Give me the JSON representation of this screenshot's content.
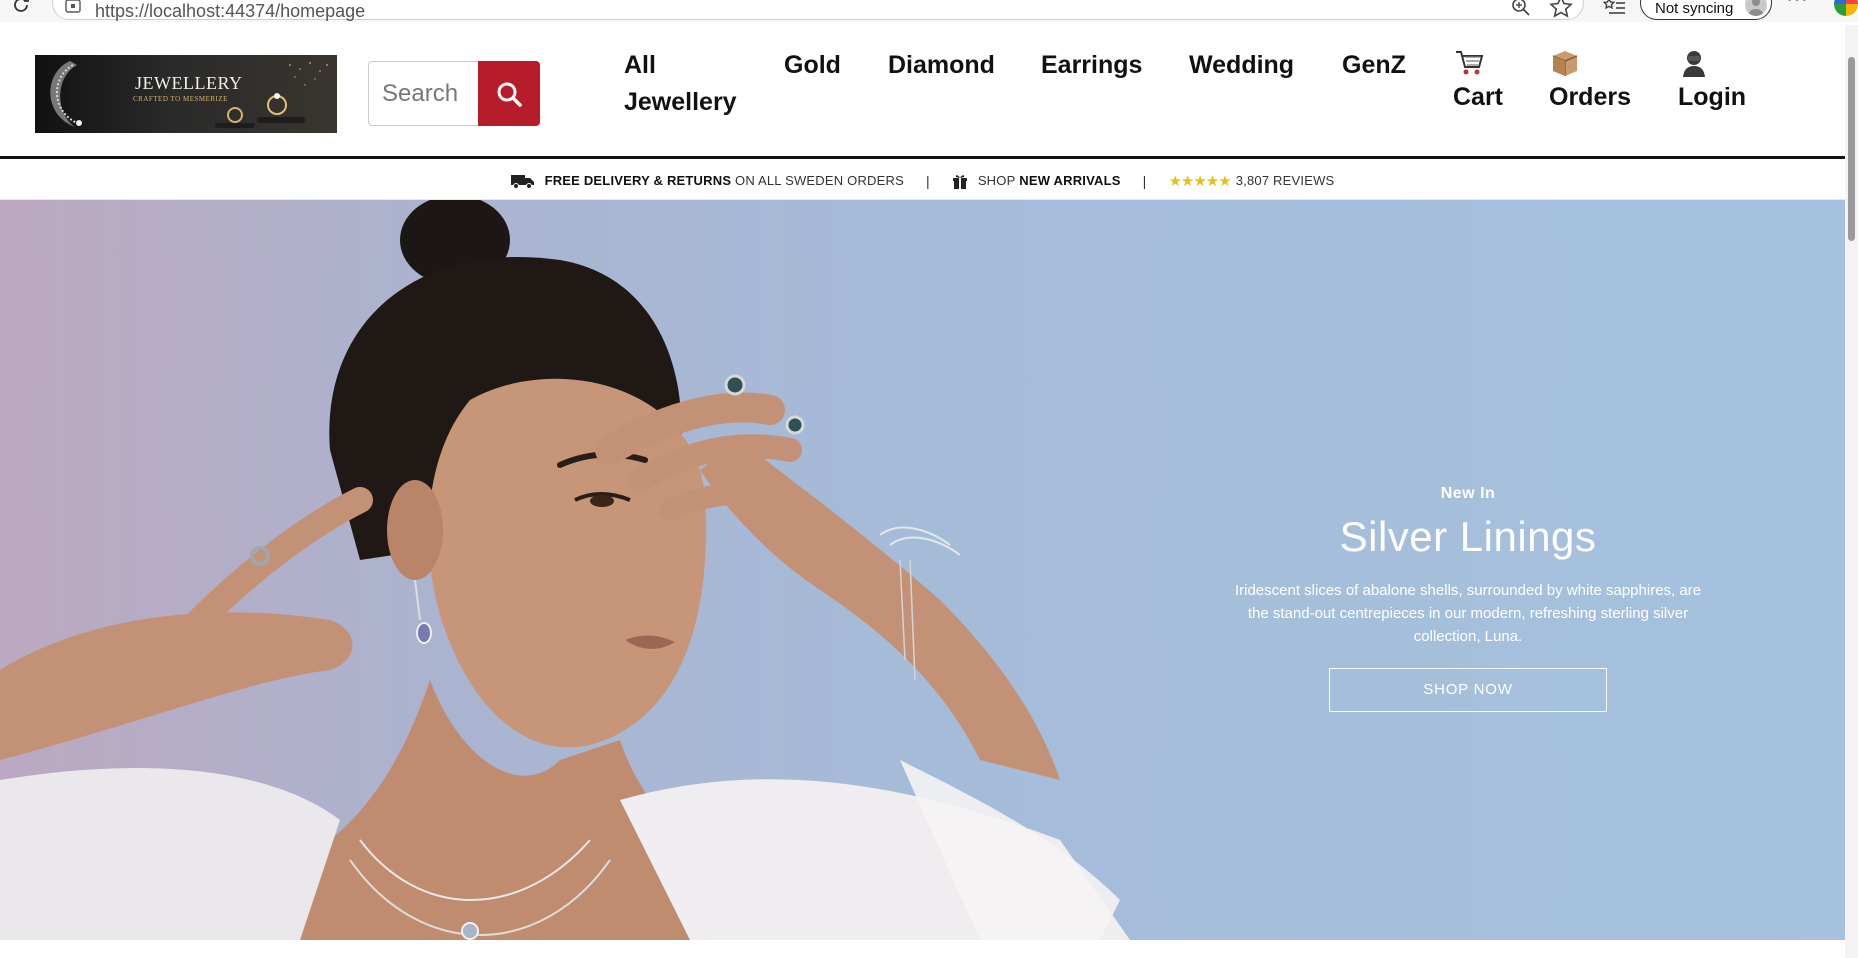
{
  "browser": {
    "url": "https://localhost:44374/homepage",
    "sync_label": "Not syncing"
  },
  "site": {
    "logo": {
      "title": "JEWELLERY",
      "subtitle": "CRAFTED TO MESMERIZE"
    },
    "search": {
      "placeholder": "Search"
    },
    "nav": [
      "All Jewellery",
      "Gold",
      "Diamond",
      "Earrings",
      "Wedding",
      "GenZ"
    ],
    "actions": {
      "cart": {
        "label": "Cart",
        "icon": "cart-icon"
      },
      "orders": {
        "label": "Orders",
        "icon": "package-icon"
      },
      "login": {
        "label": "Login",
        "icon": "user-icon"
      }
    },
    "accent_color": "#b71c2b"
  },
  "promo": {
    "delivery_bold": "FREE DELIVERY & RETURNS",
    "delivery_rest": "ON ALL SWEDEN ORDERS",
    "shop_prefix": "SHOP",
    "shop_bold": "NEW ARRIVALS",
    "rating_stars": "★★★★★",
    "reviews": "3,807 REVIEWS",
    "separator": "|"
  },
  "hero": {
    "eyebrow": "New In",
    "title": "Silver Linings",
    "description": "Iridescent slices of abalone shells, surrounded by white sapphires, are the stand-out centrepieces in our modern, refreshing sterling silver collection, Luna.",
    "cta": "SHOP NOW"
  }
}
